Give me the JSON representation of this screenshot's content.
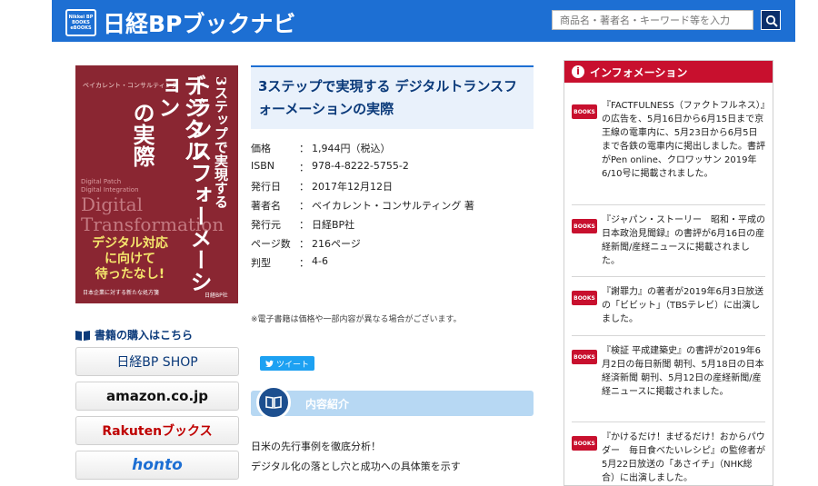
{
  "header": {
    "logo_badge_lines": [
      "Nikkei BP",
      "BOOKS",
      "eBOOKS"
    ],
    "logo_text": "日経BPブックナビ",
    "search_placeholder": "商品名・著者名・キーワード等を入力",
    "colors": {
      "brand": "#1d6fd3",
      "search_button": "#0b2f6b"
    }
  },
  "cover": {
    "author_small": "ベイカレント・コンサルティング",
    "vertical_lines": [
      "3ステップで実現する",
      "デジタル",
      "トランスフォーメーション",
      "の実際"
    ],
    "english_small": [
      "Digital Patch",
      "Digital Integration"
    ],
    "english_big": "Digital Transformation",
    "yellow_lines": [
      "デジタル対応",
      "に向けて",
      "待ったなし!"
    ],
    "subtitle": "日本企業に対する新たな処方箋",
    "publisher": "日経BP社"
  },
  "purchase": {
    "title": "書籍の購入はこちら",
    "stores": [
      "日経BP SHOP",
      "amazon.co.jp",
      "Rakutenブックス",
      "honto"
    ]
  },
  "book": {
    "title": "3ステップで実現する デジタルトランスフォーメーションの実際",
    "details": [
      {
        "key": "価格",
        "value": "1,944円（税込）"
      },
      {
        "key": "ISBN",
        "value": "978-4-8222-5755-2"
      },
      {
        "key": "発行日",
        "value": "2017年12月12日"
      },
      {
        "key": "著者名",
        "value": "ベイカレント・コンサルティング 著"
      },
      {
        "key": "発行元",
        "value": "日経BP社"
      },
      {
        "key": "ページ数",
        "value": "216ページ"
      },
      {
        "key": "判型",
        "value": "4-6"
      }
    ],
    "separator": "：",
    "note": "※電子書籍は価格や一部内容が異なる場合がございます。",
    "tweet_label": "ツイート",
    "content_label": "内容紹介",
    "description": [
      "日米の先行事例を徹底分析！",
      "デジタル化の落とし穴と成功への具体策を示す"
    ]
  },
  "information": {
    "title": "インフォメーション",
    "badge": "i",
    "book_badge": "BOOKS",
    "items": [
      {
        "text": "『FACTFULNESS（ファクトフルネス）』の広告を、5月16日から6月15日まで京王線の電車内に、5月23日から6月5日まで各鉄の電車内に掲出しました。書評がPen online、クロワッサン 2019年6/10号に掲載されました。"
      },
      {
        "text": "『ジャパン・ストーリー　昭和・平成の日本政治見聞録』の書評が6月16日の産経新聞/産経ニュースに掲載されました。"
      },
      {
        "text": "『謝罪力』の著者が2019年6月3日放送の「ビビット」（TBSテレビ）に出演しました。"
      },
      {
        "text": "『検証 平成建築史』の書評が2019年6月2日の毎日新聞 朝刊、5月18日の日本経済新聞 朝刊、5月12日の産経新聞/産経ニュースに掲載されました。"
      },
      {
        "text": "『かけるだけ！まぜるだけ！おからパウダー　毎日食べたいレシピ』の監修者が5月22日放送の「あさイチ」（NHK総合）に出演しました。"
      }
    ]
  }
}
